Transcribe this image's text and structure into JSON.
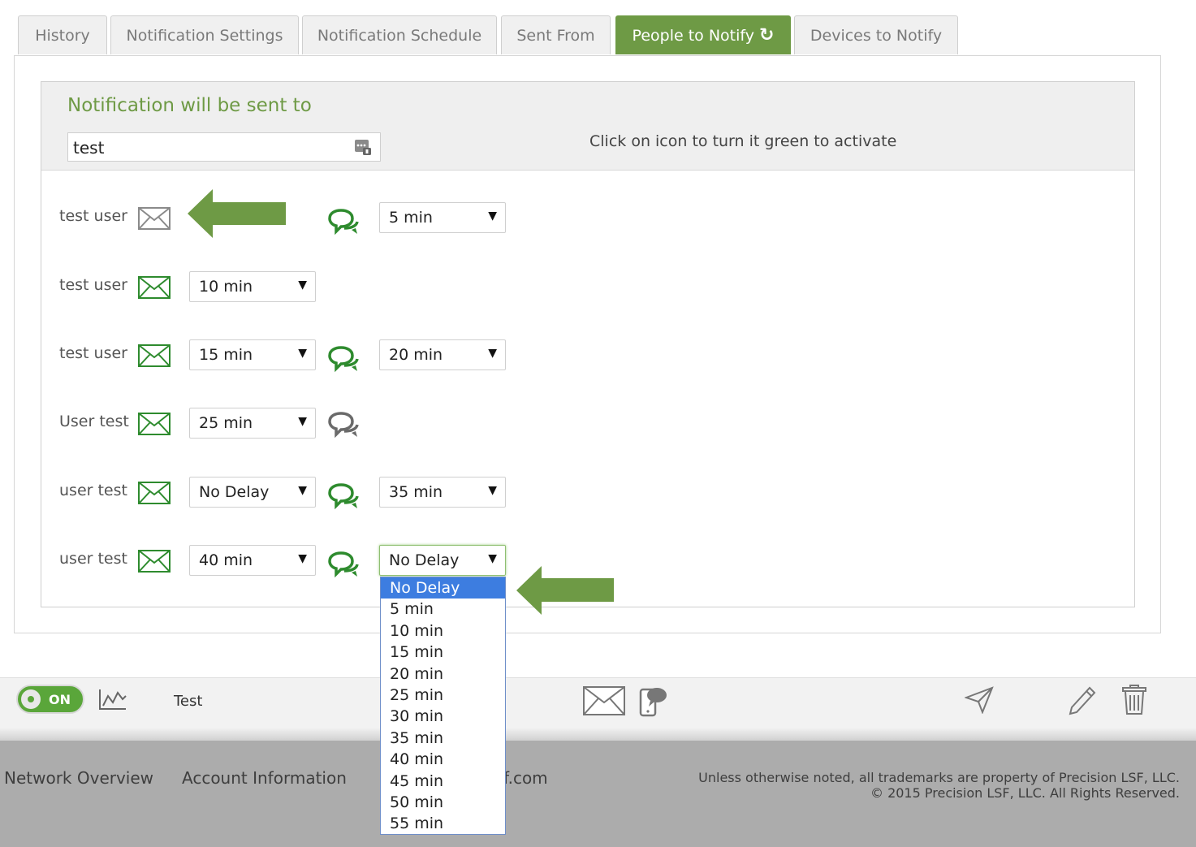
{
  "tabs": [
    {
      "label": "History"
    },
    {
      "label": "Notification Settings"
    },
    {
      "label": "Notification Schedule"
    },
    {
      "label": "Sent From"
    },
    {
      "label": "People to Notify",
      "active": true
    },
    {
      "label": "Devices to Notify"
    }
  ],
  "panel": {
    "title": "Notification will be sent to",
    "group_value": "test",
    "hint": "Click on icon to turn it green to activate"
  },
  "rows": [
    {
      "name": "test user",
      "email_active": false,
      "email_delay": "",
      "sms_active": true,
      "sms_delay": "5 min"
    },
    {
      "name": "test user",
      "email_active": true,
      "email_delay": "10 min",
      "sms_active": null,
      "sms_delay": ""
    },
    {
      "name": "test user",
      "email_active": true,
      "email_delay": "15 min",
      "sms_active": true,
      "sms_delay": "20 min"
    },
    {
      "name": "User test",
      "email_active": true,
      "email_delay": "25 min",
      "sms_active": false,
      "sms_delay": ""
    },
    {
      "name": "user test",
      "email_active": true,
      "email_delay": "No Delay",
      "sms_active": true,
      "sms_delay": "35 min"
    },
    {
      "name": "user test",
      "email_active": true,
      "email_delay": "40 min",
      "sms_active": true,
      "sms_delay": "No Delay"
    }
  ],
  "dropdown_options": [
    "No Delay",
    "5 min",
    "10 min",
    "15 min",
    "20 min",
    "25 min",
    "30 min",
    "35 min",
    "40 min",
    "45 min",
    "50 min",
    "55 min"
  ],
  "bottombar": {
    "toggle_label": "ON",
    "item_name": "Test"
  },
  "footer": {
    "links": [
      "Network Overview",
      "Account Information",
      "f.com"
    ],
    "copyright_1": "Unless otherwise noted, all trademarks are property of Precision LSF, LLC.",
    "copyright_2": "© 2015 Precision LSF, LLC. All Rights Reserved."
  },
  "colors": {
    "accent": "#6e9a45",
    "active_icon": "#2e8b2e",
    "inactive_icon": "#777777",
    "highlight": "#3d7de0",
    "footer": "#acacac"
  }
}
